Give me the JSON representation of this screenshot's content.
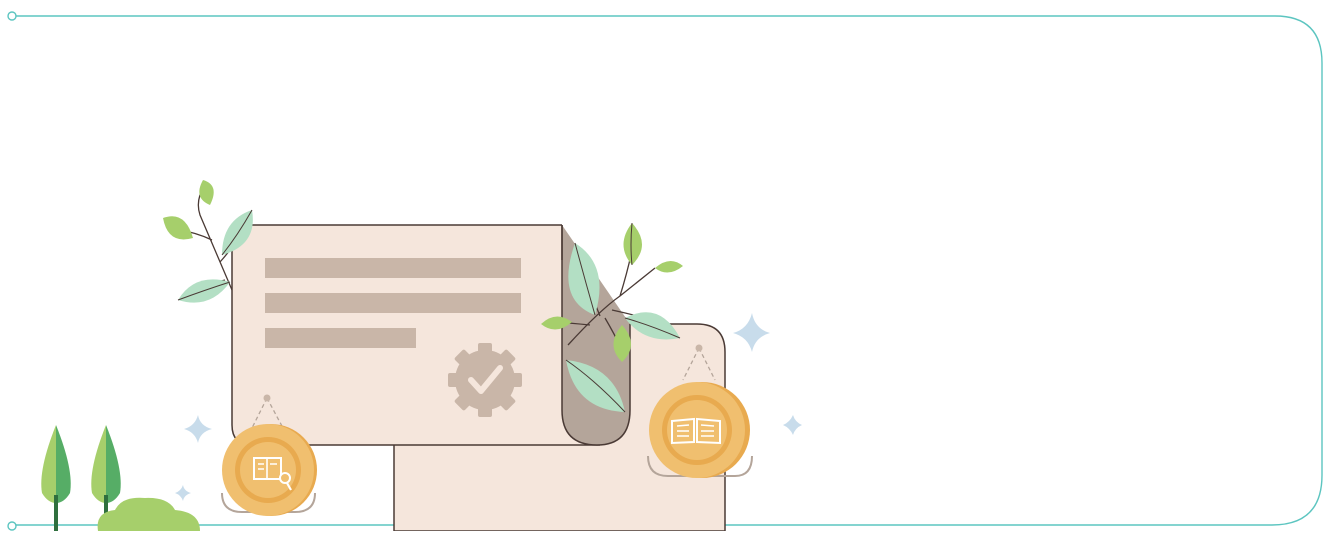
{
  "illustration": {
    "frame_color": "#5cc5c0",
    "certificate_color": "#f5e6dc",
    "bar_color": "#c9b6a8",
    "badge_color": "#c9b6a8",
    "scroll_color": "#b4a59a",
    "coin_outer": "#e8aa4f",
    "coin_inner": "#f0bf6f",
    "leaf_light": "#b3dfc4",
    "leaf_green": "#a6cf6b",
    "tree_green": "#56ad66",
    "sparkle_color": "#c8dceb",
    "stroke_color": "#4a3a35",
    "icons": [
      "check-badge-icon",
      "book-search-icon",
      "open-book-icon",
      "sparkle-icon",
      "tree-icon",
      "bush-icon",
      "leaf-branch-icon"
    ]
  }
}
